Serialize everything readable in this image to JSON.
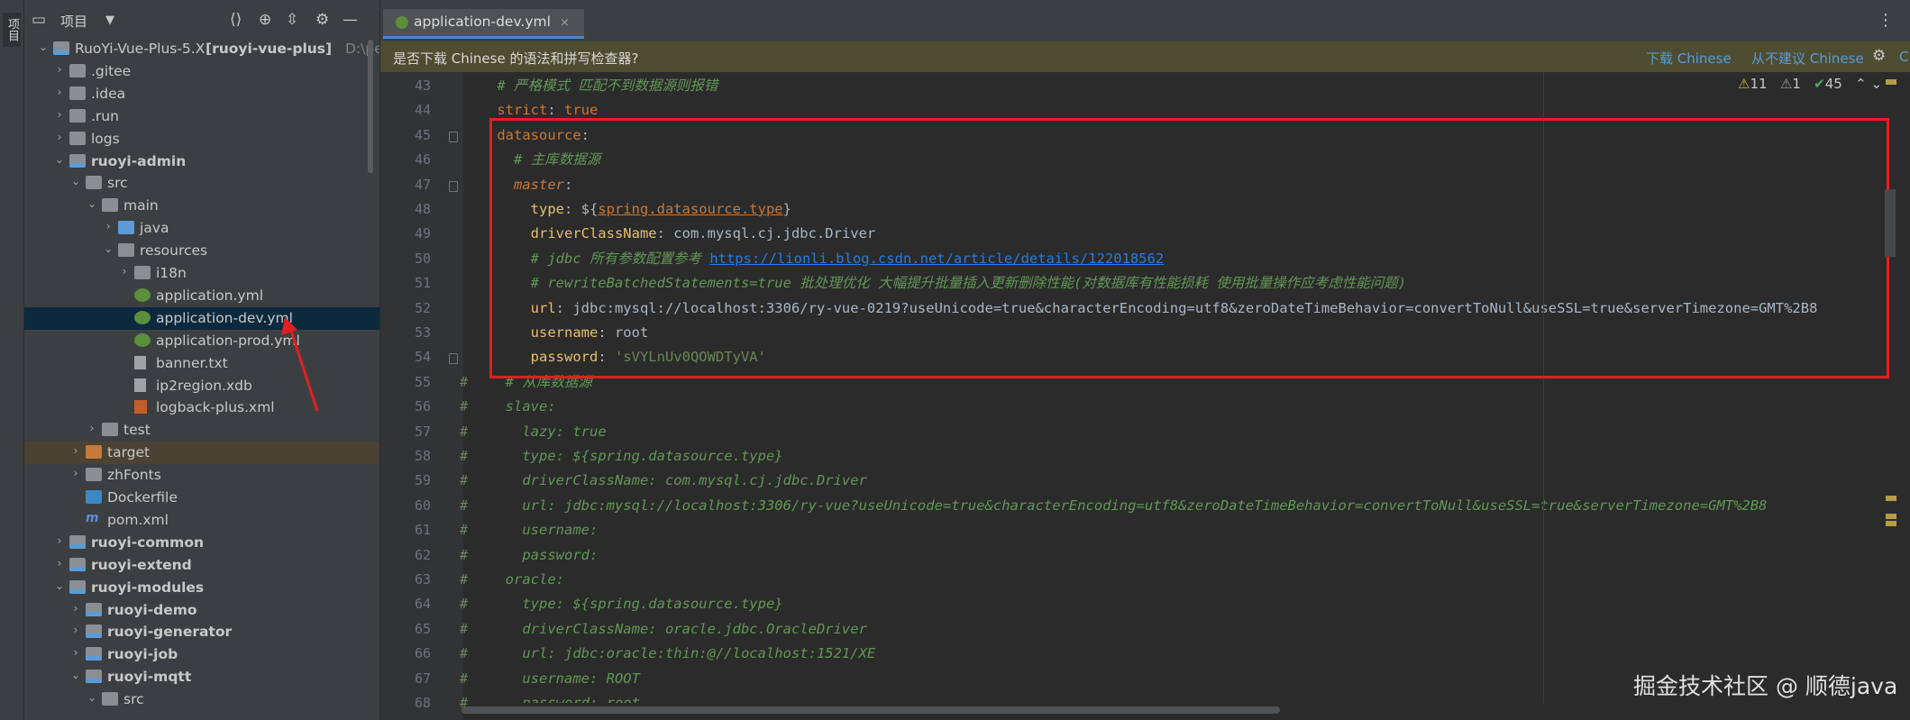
{
  "toolstrip": {
    "label": "项目"
  },
  "project_panel": {
    "title": "项目",
    "tree": [
      {
        "label": "RuoYi-Vue-Plus-5.X",
        "extra": "[ruoyi-vue-plus]",
        "path": "D:\\perso",
        "depth": 0,
        "arrow": "open",
        "icon": "module",
        "bold": false
      },
      {
        "label": ".gitee",
        "depth": 1,
        "arrow": "closed",
        "icon": "folder"
      },
      {
        "label": ".idea",
        "depth": 1,
        "arrow": "closed",
        "icon": "folder"
      },
      {
        "label": ".run",
        "depth": 1,
        "arrow": "closed",
        "icon": "folder"
      },
      {
        "label": "logs",
        "depth": 1,
        "arrow": "closed",
        "icon": "folder"
      },
      {
        "label": "ruoyi-admin",
        "depth": 1,
        "arrow": "open",
        "icon": "module",
        "bold": true
      },
      {
        "label": "src",
        "depth": 2,
        "arrow": "open",
        "icon": "folder"
      },
      {
        "label": "main",
        "depth": 3,
        "arrow": "open",
        "icon": "folder"
      },
      {
        "label": "java",
        "depth": 4,
        "arrow": "closed",
        "icon": "folder-blue"
      },
      {
        "label": "resources",
        "depth": 4,
        "arrow": "open",
        "icon": "folder-res"
      },
      {
        "label": "i18n",
        "depth": 5,
        "arrow": "closed",
        "icon": "folder"
      },
      {
        "label": "application.yml",
        "depth": 5,
        "arrow": "none",
        "icon": "yml"
      },
      {
        "label": "application-dev.yml",
        "depth": 5,
        "arrow": "none",
        "icon": "yml",
        "selected": true
      },
      {
        "label": "application-prod.yml",
        "depth": 5,
        "arrow": "none",
        "icon": "yml"
      },
      {
        "label": "banner.txt",
        "depth": 5,
        "arrow": "none",
        "icon": "txt"
      },
      {
        "label": "ip2region.xdb",
        "depth": 5,
        "arrow": "none",
        "icon": "txt"
      },
      {
        "label": "logback-plus.xml",
        "depth": 5,
        "arrow": "none",
        "icon": "xml"
      },
      {
        "label": "test",
        "depth": 3,
        "arrow": "closed",
        "icon": "folder"
      },
      {
        "label": "target",
        "depth": 2,
        "arrow": "closed",
        "icon": "folder-orange",
        "excluded": true
      },
      {
        "label": "zhFonts",
        "depth": 2,
        "arrow": "closed",
        "icon": "folder"
      },
      {
        "label": "Dockerfile",
        "depth": 2,
        "arrow": "none",
        "icon": "docker"
      },
      {
        "label": "pom.xml",
        "depth": 2,
        "arrow": "none",
        "icon": "maven"
      },
      {
        "label": "ruoyi-common",
        "depth": 1,
        "arrow": "closed",
        "icon": "module",
        "bold": true
      },
      {
        "label": "ruoyi-extend",
        "depth": 1,
        "arrow": "closed",
        "icon": "module",
        "bold": true
      },
      {
        "label": "ruoyi-modules",
        "depth": 1,
        "arrow": "open",
        "icon": "module",
        "bold": true
      },
      {
        "label": "ruoyi-demo",
        "depth": 2,
        "arrow": "closed",
        "icon": "module",
        "bold": true
      },
      {
        "label": "ruoyi-generator",
        "depth": 2,
        "arrow": "closed",
        "icon": "module",
        "bold": true
      },
      {
        "label": "ruoyi-job",
        "depth": 2,
        "arrow": "closed",
        "icon": "module",
        "bold": true
      },
      {
        "label": "ruoyi-mqtt",
        "depth": 2,
        "arrow": "open",
        "icon": "module",
        "bold": true
      },
      {
        "label": "src",
        "depth": 3,
        "arrow": "open",
        "icon": "folder"
      }
    ]
  },
  "editor": {
    "tab": {
      "label": "application-dev.yml",
      "close": "×"
    },
    "more_icon": "⋮",
    "notification": {
      "text": "是否下载 Chinese 的语法和拼写检查器?",
      "download": "下载 Chinese",
      "never": "从不建议 Chinese",
      "more": "C"
    },
    "inspections": {
      "warnings": "11",
      "weak": "1",
      "ok": "45"
    },
    "lines": [
      {
        "n": "43",
        "segs": [
          [
            "    ",
            ""
          ],
          [
            "# 严格模式 匹配不到数据源则报错",
            "cm"
          ]
        ]
      },
      {
        "n": "44",
        "segs": [
          [
            "    ",
            ""
          ],
          [
            "strict",
            "k"
          ],
          [
            ": ",
            "val"
          ],
          [
            "true",
            "k"
          ]
        ]
      },
      {
        "n": "45",
        "segs": [
          [
            "    ",
            ""
          ],
          [
            "datasource",
            "k"
          ],
          [
            ":",
            "val"
          ]
        ]
      },
      {
        "n": "46",
        "segs": [
          [
            "      ",
            ""
          ],
          [
            "# 主库数据源",
            "cm"
          ]
        ]
      },
      {
        "n": "47",
        "segs": [
          [
            "      ",
            ""
          ],
          [
            "master",
            "k ital"
          ],
          [
            ":",
            "val"
          ]
        ]
      },
      {
        "n": "48",
        "segs": [
          [
            "        ",
            ""
          ],
          [
            "type",
            "k2"
          ],
          [
            ": ${",
            "val"
          ],
          [
            "spring.datasource.type",
            "ref"
          ],
          [
            "}",
            "val"
          ]
        ]
      },
      {
        "n": "49",
        "segs": [
          [
            "        ",
            ""
          ],
          [
            "driverClassName",
            "k2"
          ],
          [
            ": com.mysql.cj.jdbc.Driver",
            "val"
          ]
        ]
      },
      {
        "n": "50",
        "segs": [
          [
            "        ",
            ""
          ],
          [
            "# jdbc 所有参数配置参考 ",
            "cm"
          ],
          [
            "https://lionli.blog.csdn.net/article/details/122018562",
            "link"
          ]
        ]
      },
      {
        "n": "51",
        "segs": [
          [
            "        ",
            ""
          ],
          [
            "# rewriteBatchedStatements=true 批处理优化 大幅提升批量插入更新删除性能(对数据库有性能损耗 使用批量操作应考虑性能问题)",
            "cm"
          ]
        ]
      },
      {
        "n": "52",
        "segs": [
          [
            "        ",
            ""
          ],
          [
            "url",
            "k2"
          ],
          [
            ": jdbc:mysql://localhost:3306/ry-vue-0219?useUnicode=true&characterEncoding=utf8&zeroDateTimeBehavior=convertToNull&useSSL=true&serverTimezone=GMT%2B8",
            "val"
          ]
        ]
      },
      {
        "n": "53",
        "segs": [
          [
            "        ",
            ""
          ],
          [
            "username",
            "k2"
          ],
          [
            ": root",
            "val"
          ]
        ]
      },
      {
        "n": "54",
        "segs": [
          [
            "        ",
            ""
          ],
          [
            "password",
            "k2"
          ],
          [
            ": ",
            "val"
          ],
          [
            "'sVYLnUv0QOWDTyVA'",
            "str"
          ]
        ]
      },
      {
        "n": "55",
        "segs": [
          [
            "     ",
            ""
          ],
          [
            "# 从库数据源",
            "cm"
          ]
        ]
      },
      {
        "n": "56",
        "segs": [
          [
            "     ",
            ""
          ],
          [
            "slave:",
            "ccode"
          ]
        ]
      },
      {
        "n": "57",
        "segs": [
          [
            "       ",
            ""
          ],
          [
            "lazy: true",
            "ccode"
          ]
        ]
      },
      {
        "n": "58",
        "segs": [
          [
            "       ",
            ""
          ],
          [
            "type: ${spring.datasource.type}",
            "ccode"
          ]
        ]
      },
      {
        "n": "59",
        "segs": [
          [
            "       ",
            ""
          ],
          [
            "driverClassName: com.mysql.cj.jdbc.Driver",
            "ccode"
          ]
        ]
      },
      {
        "n": "60",
        "segs": [
          [
            "       ",
            ""
          ],
          [
            "url: jdbc:mysql://localhost:3306/ry-vue?useUnicode=true&characterEncoding=utf8&zeroDateTimeBehavior=convertToNull&useSSL=true&serverTimezone=GMT%2B8",
            "ccode"
          ]
        ]
      },
      {
        "n": "61",
        "segs": [
          [
            "       ",
            ""
          ],
          [
            "username:",
            "ccode"
          ]
        ]
      },
      {
        "n": "62",
        "segs": [
          [
            "       ",
            ""
          ],
          [
            "password:",
            "ccode"
          ]
        ]
      },
      {
        "n": "63",
        "segs": [
          [
            "     ",
            ""
          ],
          [
            "oracle:",
            "ccode"
          ]
        ]
      },
      {
        "n": "64",
        "segs": [
          [
            "       ",
            ""
          ],
          [
            "type: ${spring.datasource.type}",
            "ccode"
          ]
        ]
      },
      {
        "n": "65",
        "segs": [
          [
            "       ",
            ""
          ],
          [
            "driverClassName: oracle.jdbc.OracleDriver",
            "ccode"
          ]
        ]
      },
      {
        "n": "66",
        "segs": [
          [
            "       ",
            ""
          ],
          [
            "url: jdbc:oracle:thin:@//localhost:1521/XE",
            "ccode"
          ]
        ]
      },
      {
        "n": "67",
        "segs": [
          [
            "       ",
            ""
          ],
          [
            "username: ROOT",
            "ccode"
          ]
        ]
      },
      {
        "n": "68",
        "segs": [
          [
            "       ",
            ""
          ],
          [
            "password: root",
            "ccode"
          ]
        ]
      }
    ],
    "commented_lines": [
      "55",
      "56",
      "57",
      "58",
      "59",
      "60",
      "61",
      "62",
      "63",
      "64",
      "65",
      "66",
      "67",
      "68"
    ],
    "fold_lines": [
      "45",
      "47",
      "54"
    ]
  },
  "watermark": "掘金技术社区 @ 顺德java",
  "colors": {
    "highlight_box": "#e02020",
    "arrow": "#e02020",
    "selected_row": "#0d293e"
  }
}
